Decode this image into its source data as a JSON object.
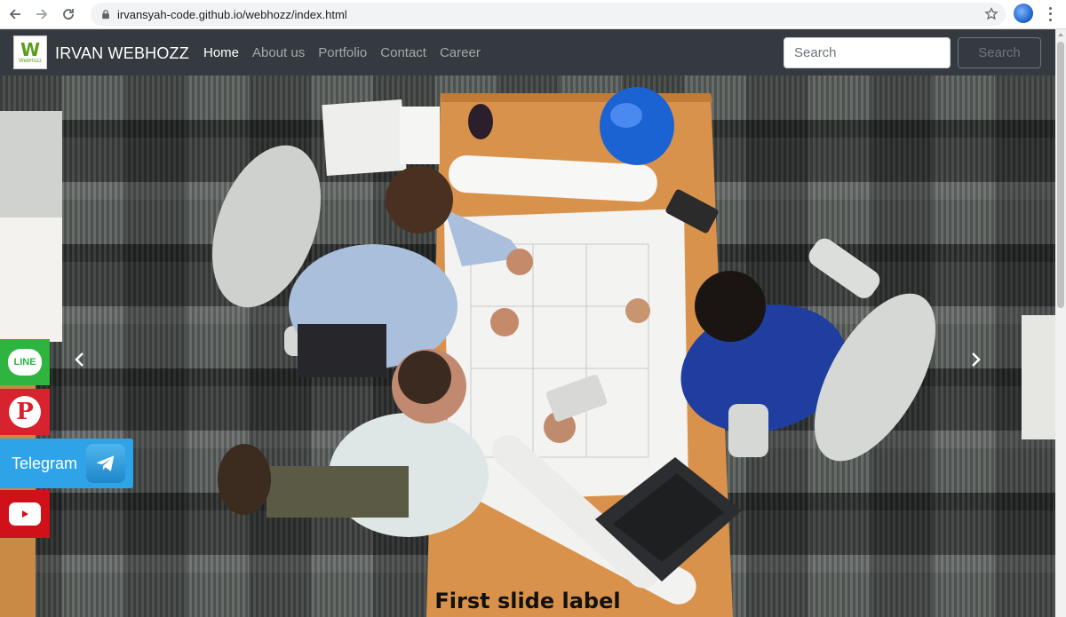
{
  "browser": {
    "url": "irvansyah-code.github.io/webhozz/index.html"
  },
  "navbar": {
    "brand_logo_text": "W",
    "brand_logo_sub": "WebHozz",
    "brand_name": "IRVAN WEBHOZZ",
    "links": [
      {
        "label": "Home",
        "active": true
      },
      {
        "label": "About us",
        "active": false
      },
      {
        "label": "Portfolio",
        "active": false
      },
      {
        "label": "Contact",
        "active": false
      },
      {
        "label": "Career",
        "active": false
      }
    ],
    "search_placeholder": "Search",
    "search_button": "Search"
  },
  "carousel": {
    "caption": "First slide label"
  },
  "social": {
    "line_label": "LINE",
    "pinterest_glyph": "P",
    "telegram_label": "Telegram"
  },
  "colors": {
    "navbar_bg": "#343a40",
    "line": "#2fb43f",
    "pinterest": "#d7232e",
    "telegram": "#2ea3e7",
    "youtube": "#d0111a"
  }
}
